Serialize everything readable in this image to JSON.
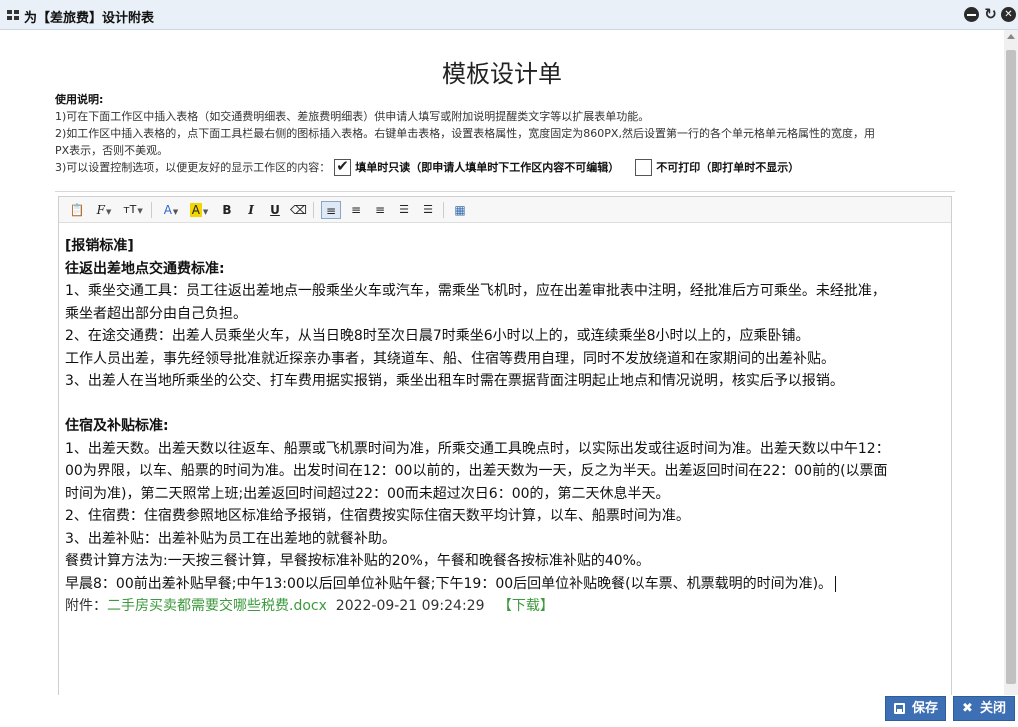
{
  "window": {
    "title": "为【差旅费】设计附表"
  },
  "doc": {
    "title": "模板设计单"
  },
  "usage": {
    "heading": "使用说明:",
    "line1": "1)可在下面工作区中插入表格（如交通费明细表、差旅费明细表）供申请人填写或附加说明提醒类文字等以扩展表单功能。",
    "line2a": "2)如工作区中插入表格的，点下面工具栏最右侧的图标插入表格。右键单击表格，设置表格属性，宽度固定为860PX,然后设置第一行的各个单元格单元格属性的宽度，用",
    "line2b": "PX表示，否则不美观。",
    "line3": "3)可以设置控制选项，以便更友好的显示工作区的内容：",
    "option_readonly": "填单时只读（即申请人填单时下工作区内容不可编辑）",
    "option_readonly_checked": true,
    "option_noprint": "不可打印（即打单时不显示）",
    "option_noprint_checked": false
  },
  "editor": {
    "lines": {
      "l1": "[报销标准]",
      "l2": "往返出差地点交通费标准:",
      "l3": "1、乘坐交通工具：员工往返出差地点一般乘坐火车或汽车，需乘坐飞机时，应在出差审批表中注明，经批准后方可乘坐。未经批准，",
      "l4": "乘坐者超出部分由自己负担。",
      "l5": "2、在途交通费：出差人员乘坐火车，从当日晚8时至次日晨7时乘坐6小时以上的，或连续乘坐8小时以上的，应乘卧铺。",
      "l6": "工作人员出差，事先经领导批准就近探亲办事者，其绕道车、船、住宿等费用自理，同时不发放绕道和在家期间的出差补贴。",
      "l7": "3、出差人在当地所乘坐的公交、打车费用据实报销，乘坐出租车时需在票据背面注明起止地点和情况说明，核实后予以报销。",
      "l8": "住宿及补贴标准:",
      "l9": "1、出差天数。出差天数以往返车、船票或飞机票时间为准，所乘交通工具晚点时，以实际出发或往返时间为准。出差天数以中午12：",
      "l10": "00为界限，以车、船票的时间为准。出发时间在12：00以前的，出差天数为一天，反之为半天。出差返回时间在22：00前的(以票面",
      "l11": "时间为准)，第二天照常上班;出差返回时间超过22：00而未超过次日6：00的，第二天休息半天。",
      "l12": "2、住宿费：住宿费参照地区标准给予报销，住宿费按实际住宿天数平均计算，以车、船票时间为准。",
      "l13": "3、出差补贴：出差补贴为员工在出差地的就餐补助。",
      "l14": "餐费计算方法为:一天按三餐计算，早餐按标准补贴的20%，午餐和晚餐各按标准补贴的40%。",
      "l15": "早晨8：00前出差补贴早餐;中午13:00以后回单位补贴午餐;下午19：00后回单位补贴晚餐(以车票、机票载明的时间为准)。"
    },
    "attachment": {
      "label": "附件：",
      "filename": "二手房买卖都需要交哪些税费.docx",
      "datetime": "2022-09-21 09:24:29",
      "download": "【下载】"
    }
  },
  "buttons": {
    "save": "保存",
    "close": "关闭"
  },
  "colors": {
    "primary_button": "#3d6fb5",
    "attachment_link": "#3c9a3c"
  }
}
